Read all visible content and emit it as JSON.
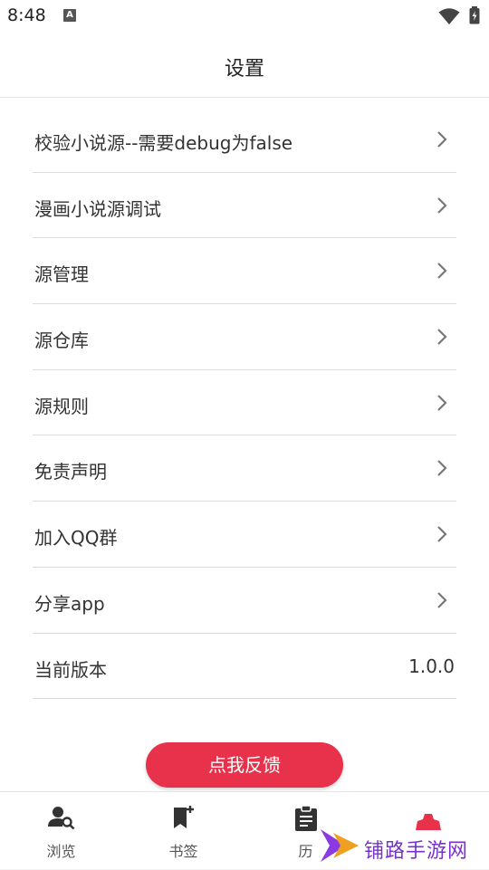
{
  "status": {
    "time": "8:48",
    "a_badge": "A"
  },
  "header": {
    "title": "设置"
  },
  "settings": {
    "items": [
      {
        "label": "校验小说源--需要debug为false"
      },
      {
        "label": "漫画小说源调试"
      },
      {
        "label": "源管理"
      },
      {
        "label": "源仓库"
      },
      {
        "label": "源规则"
      },
      {
        "label": "免责声明"
      },
      {
        "label": "加入QQ群"
      },
      {
        "label": "分享app"
      }
    ],
    "version": {
      "label": "当前版本",
      "value": "1.0.0"
    }
  },
  "feedback": {
    "label": "点我反馈"
  },
  "tabs": [
    {
      "label": "浏览",
      "icon": "person-search-icon"
    },
    {
      "label": "书签",
      "icon": "bookmark-add-icon"
    },
    {
      "label": "历",
      "icon": "clipboard-icon"
    },
    {
      "label": "",
      "icon": "settings-icon"
    }
  ],
  "watermark": {
    "text": "铺路手游网"
  },
  "colors": {
    "accent": "#e8314a",
    "watermark": "#7a2fd0"
  }
}
